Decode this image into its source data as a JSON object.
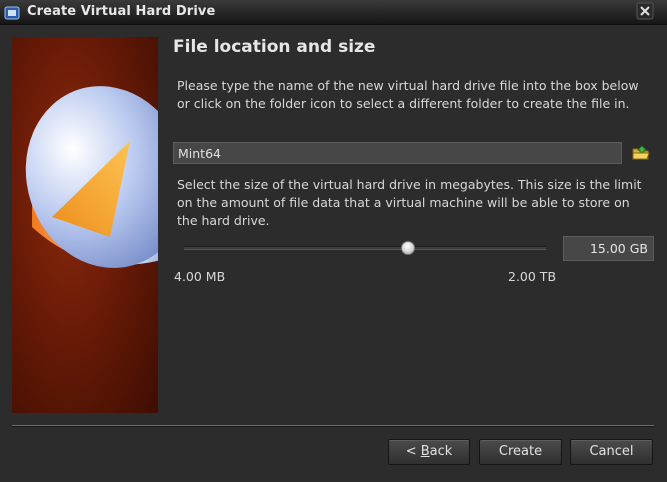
{
  "window": {
    "title": "Create Virtual Hard Drive",
    "icon": "virtualbox-icon",
    "close_icon": "close-icon"
  },
  "page": {
    "heading": "File location and size",
    "location_description": "Please type the name of the new virtual hard drive file into the box below or click on the folder icon to select a different folder to create the file in.",
    "file_name": "Mint64",
    "folder_icon": "folder-icon",
    "size_description": "Select the size of the virtual hard drive in megabytes. This size is the limit on the amount of file data that a virtual machine will be able to store on the hard drive.",
    "size_value": "15.00 GB",
    "size_slider_fraction": 0.62,
    "range_min": "4.00 MB",
    "range_max": "2.00 TB"
  },
  "buttons": {
    "back_prefix": "< ",
    "back_mnemonic": "B",
    "back_rest": "ack",
    "create": "Create",
    "cancel": "Cancel"
  },
  "colors": {
    "background": "#2c2c2c",
    "side_panel": "#6a1b07",
    "disk_top": "#9fb4e6",
    "pie_slice": "#f0a020"
  }
}
